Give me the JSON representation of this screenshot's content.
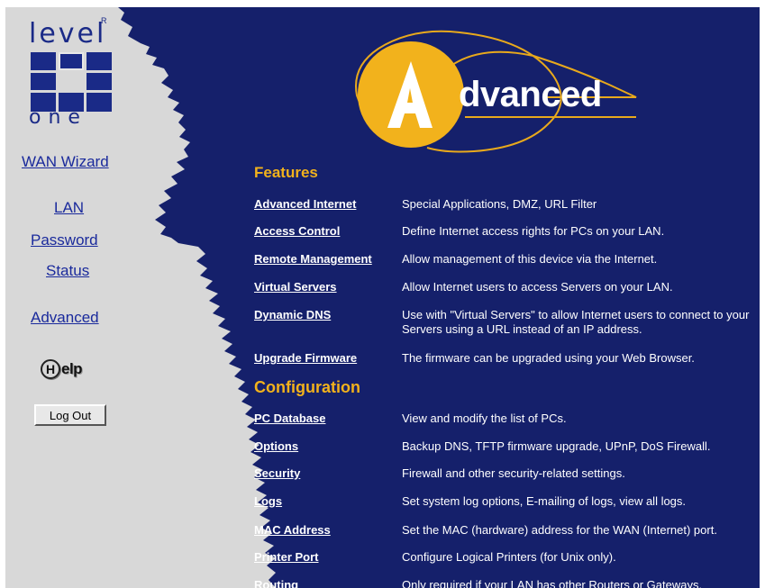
{
  "logo": {
    "top_text": "level",
    "reg_mark": "R",
    "bottom_text": "one"
  },
  "nav": {
    "wan_wizard": "WAN Wizard",
    "lan": "LAN",
    "password": "Password",
    "status": "Status",
    "advanced": "Advanced",
    "help_letter": "H",
    "help_text": "elp",
    "logout": "Log Out"
  },
  "banner": {
    "letter": "A",
    "word": "dvanced"
  },
  "colors": {
    "background": "#15206b",
    "accent": "#f2b21c",
    "paper": "#d8d8d8",
    "link": "#1a2a9c"
  },
  "features": {
    "title": "Features",
    "items": [
      {
        "label": "Advanced Internet",
        "desc": "Special Applications, DMZ, URL Filter"
      },
      {
        "label": "Access Control",
        "desc": "Define Internet access rights for PCs on your LAN."
      },
      {
        "label": "Remote Management",
        "desc": "Allow management of this device via the Internet."
      },
      {
        "label": "Virtual Servers",
        "desc": "Allow Internet users to access Servers on your LAN."
      },
      {
        "label": "Dynamic DNS",
        "desc": "Use with \"Virtual Servers\" to allow Internet users to connect to your Servers using a URL instead of an IP address."
      },
      {
        "label": "Upgrade Firmware",
        "desc": "The firmware can be upgraded using your Web Browser."
      }
    ]
  },
  "configuration": {
    "title": "Configuration",
    "items": [
      {
        "label": "PC Database",
        "desc": "View and modify the list of PCs."
      },
      {
        "label": "Options",
        "desc": "Backup DNS, TFTP firmware upgrade, UPnP, DoS Firewall."
      },
      {
        "label": "Security",
        "desc": "Firewall and other security-related settings."
      },
      {
        "label": "Logs",
        "desc": "Set system log options, E-mailing of logs, view all logs."
      },
      {
        "label": "MAC Address",
        "desc": "Set the MAC (hardware) address for the WAN (Internet) port."
      },
      {
        "label": "Printer Port",
        "desc": "Configure Logical Printers (for Unix only)."
      },
      {
        "label": "Routing",
        "desc": "Only required if your LAN has other Routers or Gateways."
      }
    ]
  }
}
